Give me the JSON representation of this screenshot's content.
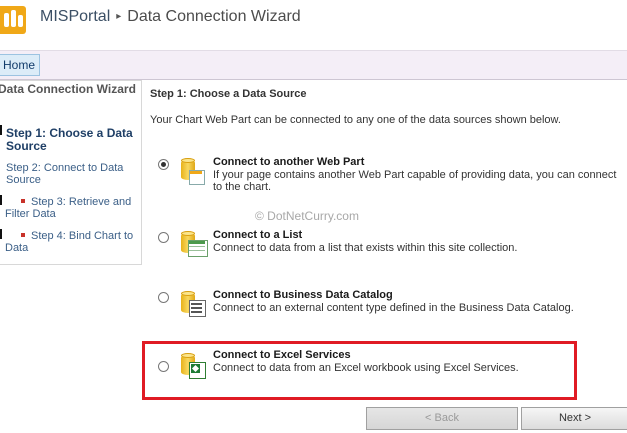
{
  "header": {
    "site_name": "MISPortal",
    "separator": "▸",
    "page_title": "Data Connection Wizard"
  },
  "ribbon": {
    "home_tab": "Home"
  },
  "leftnav": {
    "title": "Data Connection Wizard",
    "steps": [
      {
        "label": "Step 1: Choose a Data Source",
        "active": true
      },
      {
        "label": "Step 2: Connect to Data Source",
        "active": false
      },
      {
        "label": "Step 3: Retrieve and Filter Data",
        "active": false
      },
      {
        "label": "Step 4: Bind Chart to Data",
        "active": false
      }
    ]
  },
  "main": {
    "step_title": "Step 1: Choose a Data Source",
    "intro": "Your Chart Web Part can be connected to any one of the data sources shown below.",
    "options": [
      {
        "title": "Connect to another Web Part",
        "description": "If your page contains another Web Part capable of providing data, you can connect to the chart.",
        "selected": true,
        "icon": "web-part-database-icon"
      },
      {
        "title": "Connect to a List",
        "description": "Connect to data from a list that exists within this site collection.",
        "selected": false,
        "icon": "list-database-icon"
      },
      {
        "title": "Connect to Business Data Catalog",
        "description": "Connect to an external content type defined in the Business Data Catalog.",
        "selected": false,
        "icon": "bdc-database-icon"
      },
      {
        "title": "Connect to Excel Services",
        "description": "Connect to data from an Excel workbook using Excel Services.",
        "selected": false,
        "icon": "excel-database-icon"
      }
    ],
    "watermark": "© DotNetCurry.com"
  },
  "buttons": {
    "back": "< Back",
    "next": "Next >"
  },
  "colors": {
    "highlight": "#e01b24",
    "logo": "#f0a818",
    "ribbon": "#f4eef7"
  }
}
